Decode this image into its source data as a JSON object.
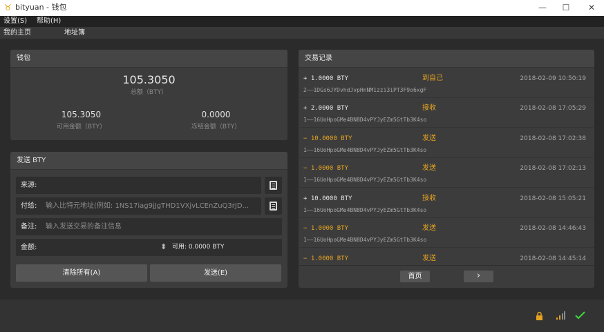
{
  "window": {
    "title": "bityuan - 钱包",
    "minimize": "—",
    "maximize": "☐",
    "close": "✕"
  },
  "menu": {
    "settings": "设置(S)",
    "help": "帮助(H)"
  },
  "nav": {
    "home": "我的主页",
    "addressbook": "地址簿"
  },
  "wallet": {
    "header": "钱包",
    "total_value": "105.3050",
    "total_label": "总额（BTY）",
    "available_value": "105.3050",
    "available_label": "可用金额（BTY）",
    "frozen_value": "0.0000",
    "frozen_label": "冻结金额（BTY）"
  },
  "send": {
    "header": "发送 BTY",
    "from_label": "来源:",
    "to_label": "付给:",
    "to_placeholder": "输入比特元地址(例如: 1NS17iag9jJgTHD1VXjvLCEnZuQ3rJD...",
    "note_label": "备注:",
    "note_placeholder": "输入发送交易的备注信息",
    "amount_label": "金额:",
    "spin": "⬍",
    "available_text": "可用: 0.0000 BTY",
    "clear_button": "清除所有(A)",
    "send_button": "发送(E)"
  },
  "transactions": {
    "header": "交易记录",
    "items": [
      {
        "amount": "+ 1.0000 BTY",
        "type": "到自己",
        "date": "2018-02-09 10:50:19",
        "address": "2——1DGs6JYDvhdJvpHnNM1zzi3iPT3F9o6xgF",
        "negative": false
      },
      {
        "amount": "+ 2.0000 BTY",
        "type": "接收",
        "date": "2018-02-08 17:05:29",
        "address": "1——16UoHpoGMe4BN8D4vPYJyEZm5GtTb3K4so",
        "negative": false
      },
      {
        "amount": "− 10.0000 BTY",
        "type": "发送",
        "date": "2018-02-08 17:02:38",
        "address": "1——16UoHpoGMe4BN8D4vPYJyEZm5GtTb3K4so",
        "negative": true
      },
      {
        "amount": "− 1.0000 BTY",
        "type": "发送",
        "date": "2018-02-08 17:02:13",
        "address": "1——16UoHpoGMe4BN8D4vPYJyEZm5GtTb3K4so",
        "negative": true
      },
      {
        "amount": "+ 10.0000 BTY",
        "type": "接收",
        "date": "2018-02-08 15:05:21",
        "address": "1——16UoHpoGMe4BN8D4vPYJyEZm5GtTb3K4so",
        "negative": false
      },
      {
        "amount": "− 1.0000 BTY",
        "type": "发送",
        "date": "2018-02-08 14:46:43",
        "address": "1——16UoHpoGMe4BN8D4vPYJyEZm5GtTb3K4so",
        "negative": true
      },
      {
        "amount": "− 1.0000 BTY",
        "type": "发送",
        "date": "2018-02-08 14:45:14",
        "address": "",
        "negative": true
      }
    ],
    "first_page_button": "首页",
    "next_button": "›"
  },
  "status": {
    "lock_icon": "lock-icon",
    "signal_icon": "signal-icon",
    "check_icon": "check-icon",
    "accent": "#e5a321",
    "ok_color": "#3fcf3f"
  }
}
